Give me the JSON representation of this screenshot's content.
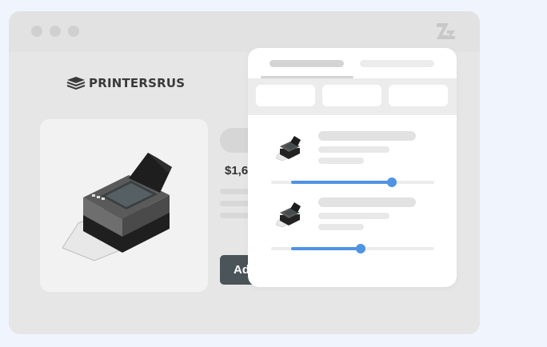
{
  "store": {
    "brand": "PRINTERSRUS",
    "price_prefix": "$1,6",
    "add_button_label": "Ad"
  },
  "colors": {
    "accent": "#4f93e3",
    "page_bg": "#f0f5fd",
    "button_bg": "#4a5459"
  },
  "icons": {
    "app_logo": "z-logo-icon",
    "store_logo": "stacked-layers-icon",
    "product": "printer-icon"
  },
  "comparison": {
    "items": [
      {
        "icon": "printer-icon",
        "slider_level": 0.74
      },
      {
        "icon": "printer-icon",
        "slider_level": 0.55
      }
    ]
  }
}
